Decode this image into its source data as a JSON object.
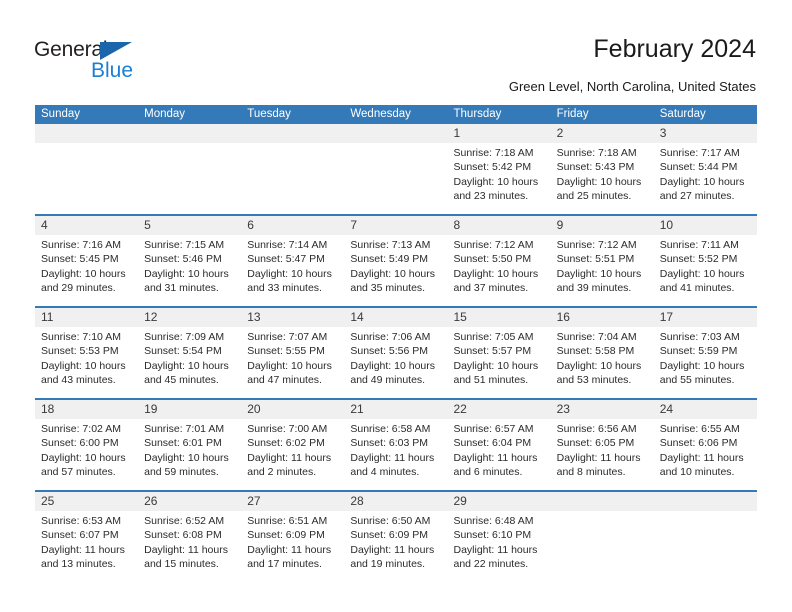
{
  "brand": {
    "name_part1": "General",
    "name_part2": "Blue",
    "primary_color": "#1b7fd4",
    "triangle_color": "#1b66ab"
  },
  "header": {
    "title": "February 2024",
    "subtitle": "Green Level, North Carolina, United States",
    "header_bg_color": "#3479b8",
    "header_text_color": "#ffffff"
  },
  "calendar": {
    "weekday_headers": [
      "Sunday",
      "Monday",
      "Tuesday",
      "Wednesday",
      "Thursday",
      "Friday",
      "Saturday"
    ],
    "weeks": [
      [
        {
          "day": "",
          "sunrise": "",
          "sunset": "",
          "daylight": "",
          "empty": true
        },
        {
          "day": "",
          "sunrise": "",
          "sunset": "",
          "daylight": "",
          "empty": true
        },
        {
          "day": "",
          "sunrise": "",
          "sunset": "",
          "daylight": "",
          "empty": true
        },
        {
          "day": "",
          "sunrise": "",
          "sunset": "",
          "daylight": "",
          "empty": true
        },
        {
          "day": "1",
          "sunrise": "Sunrise: 7:18 AM",
          "sunset": "Sunset: 5:42 PM",
          "daylight": "Daylight: 10 hours and 23 minutes.",
          "empty": false
        },
        {
          "day": "2",
          "sunrise": "Sunrise: 7:18 AM",
          "sunset": "Sunset: 5:43 PM",
          "daylight": "Daylight: 10 hours and 25 minutes.",
          "empty": false
        },
        {
          "day": "3",
          "sunrise": "Sunrise: 7:17 AM",
          "sunset": "Sunset: 5:44 PM",
          "daylight": "Daylight: 10 hours and 27 minutes.",
          "empty": false
        }
      ],
      [
        {
          "day": "4",
          "sunrise": "Sunrise: 7:16 AM",
          "sunset": "Sunset: 5:45 PM",
          "daylight": "Daylight: 10 hours and 29 minutes.",
          "empty": false
        },
        {
          "day": "5",
          "sunrise": "Sunrise: 7:15 AM",
          "sunset": "Sunset: 5:46 PM",
          "daylight": "Daylight: 10 hours and 31 minutes.",
          "empty": false
        },
        {
          "day": "6",
          "sunrise": "Sunrise: 7:14 AM",
          "sunset": "Sunset: 5:47 PM",
          "daylight": "Daylight: 10 hours and 33 minutes.",
          "empty": false
        },
        {
          "day": "7",
          "sunrise": "Sunrise: 7:13 AM",
          "sunset": "Sunset: 5:49 PM",
          "daylight": "Daylight: 10 hours and 35 minutes.",
          "empty": false
        },
        {
          "day": "8",
          "sunrise": "Sunrise: 7:12 AM",
          "sunset": "Sunset: 5:50 PM",
          "daylight": "Daylight: 10 hours and 37 minutes.",
          "empty": false
        },
        {
          "day": "9",
          "sunrise": "Sunrise: 7:12 AM",
          "sunset": "Sunset: 5:51 PM",
          "daylight": "Daylight: 10 hours and 39 minutes.",
          "empty": false
        },
        {
          "day": "10",
          "sunrise": "Sunrise: 7:11 AM",
          "sunset": "Sunset: 5:52 PM",
          "daylight": "Daylight: 10 hours and 41 minutes.",
          "empty": false
        }
      ],
      [
        {
          "day": "11",
          "sunrise": "Sunrise: 7:10 AM",
          "sunset": "Sunset: 5:53 PM",
          "daylight": "Daylight: 10 hours and 43 minutes.",
          "empty": false
        },
        {
          "day": "12",
          "sunrise": "Sunrise: 7:09 AM",
          "sunset": "Sunset: 5:54 PM",
          "daylight": "Daylight: 10 hours and 45 minutes.",
          "empty": false
        },
        {
          "day": "13",
          "sunrise": "Sunrise: 7:07 AM",
          "sunset": "Sunset: 5:55 PM",
          "daylight": "Daylight: 10 hours and 47 minutes.",
          "empty": false
        },
        {
          "day": "14",
          "sunrise": "Sunrise: 7:06 AM",
          "sunset": "Sunset: 5:56 PM",
          "daylight": "Daylight: 10 hours and 49 minutes.",
          "empty": false
        },
        {
          "day": "15",
          "sunrise": "Sunrise: 7:05 AM",
          "sunset": "Sunset: 5:57 PM",
          "daylight": "Daylight: 10 hours and 51 minutes.",
          "empty": false
        },
        {
          "day": "16",
          "sunrise": "Sunrise: 7:04 AM",
          "sunset": "Sunset: 5:58 PM",
          "daylight": "Daylight: 10 hours and 53 minutes.",
          "empty": false
        },
        {
          "day": "17",
          "sunrise": "Sunrise: 7:03 AM",
          "sunset": "Sunset: 5:59 PM",
          "daylight": "Daylight: 10 hours and 55 minutes.",
          "empty": false
        }
      ],
      [
        {
          "day": "18",
          "sunrise": "Sunrise: 7:02 AM",
          "sunset": "Sunset: 6:00 PM",
          "daylight": "Daylight: 10 hours and 57 minutes.",
          "empty": false
        },
        {
          "day": "19",
          "sunrise": "Sunrise: 7:01 AM",
          "sunset": "Sunset: 6:01 PM",
          "daylight": "Daylight: 10 hours and 59 minutes.",
          "empty": false
        },
        {
          "day": "20",
          "sunrise": "Sunrise: 7:00 AM",
          "sunset": "Sunset: 6:02 PM",
          "daylight": "Daylight: 11 hours and 2 minutes.",
          "empty": false
        },
        {
          "day": "21",
          "sunrise": "Sunrise: 6:58 AM",
          "sunset": "Sunset: 6:03 PM",
          "daylight": "Daylight: 11 hours and 4 minutes.",
          "empty": false
        },
        {
          "day": "22",
          "sunrise": "Sunrise: 6:57 AM",
          "sunset": "Sunset: 6:04 PM",
          "daylight": "Daylight: 11 hours and 6 minutes.",
          "empty": false
        },
        {
          "day": "23",
          "sunrise": "Sunrise: 6:56 AM",
          "sunset": "Sunset: 6:05 PM",
          "daylight": "Daylight: 11 hours and 8 minutes.",
          "empty": false
        },
        {
          "day": "24",
          "sunrise": "Sunrise: 6:55 AM",
          "sunset": "Sunset: 6:06 PM",
          "daylight": "Daylight: 11 hours and 10 minutes.",
          "empty": false
        }
      ],
      [
        {
          "day": "25",
          "sunrise": "Sunrise: 6:53 AM",
          "sunset": "Sunset: 6:07 PM",
          "daylight": "Daylight: 11 hours and 13 minutes.",
          "empty": false
        },
        {
          "day": "26",
          "sunrise": "Sunrise: 6:52 AM",
          "sunset": "Sunset: 6:08 PM",
          "daylight": "Daylight: 11 hours and 15 minutes.",
          "empty": false
        },
        {
          "day": "27",
          "sunrise": "Sunrise: 6:51 AM",
          "sunset": "Sunset: 6:09 PM",
          "daylight": "Daylight: 11 hours and 17 minutes.",
          "empty": false
        },
        {
          "day": "28",
          "sunrise": "Sunrise: 6:50 AM",
          "sunset": "Sunset: 6:09 PM",
          "daylight": "Daylight: 11 hours and 19 minutes.",
          "empty": false
        },
        {
          "day": "29",
          "sunrise": "Sunrise: 6:48 AM",
          "sunset": "Sunset: 6:10 PM",
          "daylight": "Daylight: 11 hours and 22 minutes.",
          "empty": false
        },
        {
          "day": "",
          "sunrise": "",
          "sunset": "",
          "daylight": "",
          "empty": true
        },
        {
          "day": "",
          "sunrise": "",
          "sunset": "",
          "daylight": "",
          "empty": true
        }
      ]
    ]
  }
}
